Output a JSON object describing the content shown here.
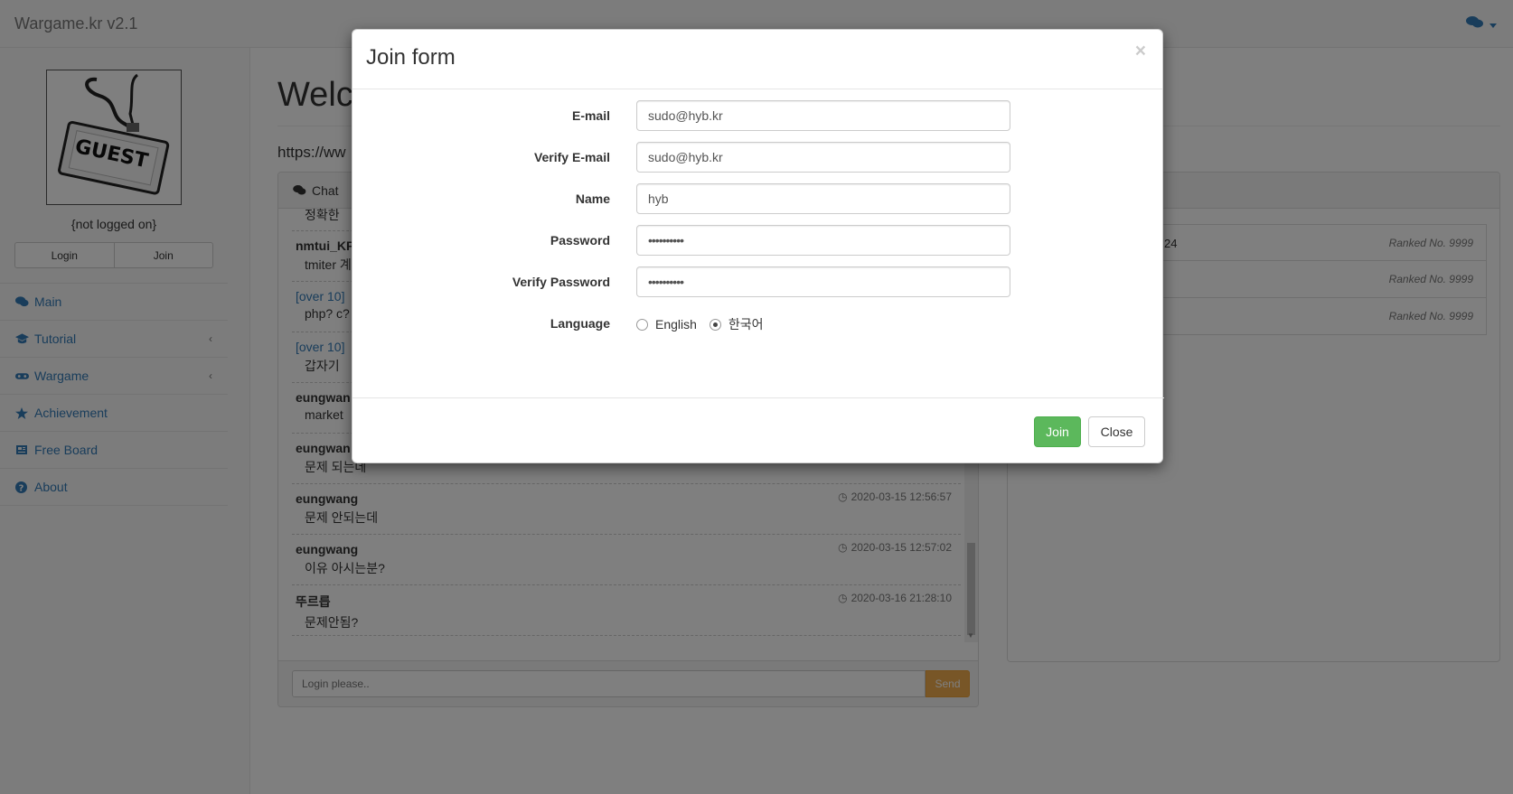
{
  "navbar": {
    "brand": "Wargame.kr v2.1",
    "chat_icon": "comments-icon"
  },
  "sidebar": {
    "avatar_label": "GUEST",
    "status": "{not logged on}",
    "login_label": "Login",
    "join_label": "Join",
    "menu": [
      {
        "label": "Main",
        "icon": "comments-icon"
      },
      {
        "label": "Tutorial",
        "icon": "graduation-cap-icon"
      },
      {
        "label": "Wargame",
        "icon": "gamepad-icon"
      },
      {
        "label": "Achievement",
        "icon": "star-icon"
      },
      {
        "label": "Free Board",
        "icon": "newspaper-icon"
      },
      {
        "label": "About",
        "icon": "question-circle-icon"
      }
    ]
  },
  "main": {
    "welcome": "Welc",
    "url": "https://ww"
  },
  "chat": {
    "title": "Chat",
    "messages": [
      {
        "author": "",
        "text": "정확한 ",
        "time": ""
      },
      {
        "author": "nmtui_KF",
        "text": "tmiter 계",
        "time": ""
      },
      {
        "author": "[over 10] ",
        "text": "php? c?",
        "time": ""
      },
      {
        "author": "[over 10] ",
        "text": "갑자기 ",
        "time": ""
      },
      {
        "author": "eungwan",
        "text": "market",
        "time": ""
      },
      {
        "author": "eungwan",
        "text": "문제 되는데",
        "time": ""
      },
      {
        "author": "eungwang",
        "text": "문제 안되는데",
        "time": "2020-03-15 12:56:57"
      },
      {
        "author": "eungwang",
        "text": "이유 아시는분?",
        "time": "2020-03-15 12:57:02"
      },
      {
        "author": "뚜르릅",
        "text": "문제안됨?",
        "time": "2020-03-16 21:28:10"
      }
    ],
    "input_placeholder": "Login please..",
    "send_label": "Send"
  },
  "ranking": {
    "rows": [
      {
        "fragment": "24",
        "rank": "Ranked No. 9999"
      },
      {
        "fragment": "",
        "rank": "Ranked No. 9999"
      },
      {
        "fragment": "",
        "rank": "Ranked No. 9999"
      }
    ]
  },
  "modal": {
    "title": "Join form",
    "close_symbol": "×",
    "fields": [
      {
        "label": "E-mail",
        "value": "sudo@hyb.kr",
        "type": "text"
      },
      {
        "label": "Verify E-mail",
        "value": "sudo@hyb.kr",
        "type": "text"
      },
      {
        "label": "Name",
        "value": "hyb",
        "type": "text"
      },
      {
        "label": "Password",
        "value": "••••••••••",
        "type": "password"
      },
      {
        "label": "Verify Password",
        "value": "••••••••••",
        "type": "password"
      }
    ],
    "language": {
      "label": "Language",
      "options": [
        {
          "label": "English",
          "selected": false
        },
        {
          "label": "한국어",
          "selected": true
        }
      ]
    },
    "join_label": "Join",
    "close_label": "Close",
    "colors": {
      "join_button": "#5cb85c",
      "send_button": "#f0ad4e",
      "link": "#337ab7"
    }
  }
}
